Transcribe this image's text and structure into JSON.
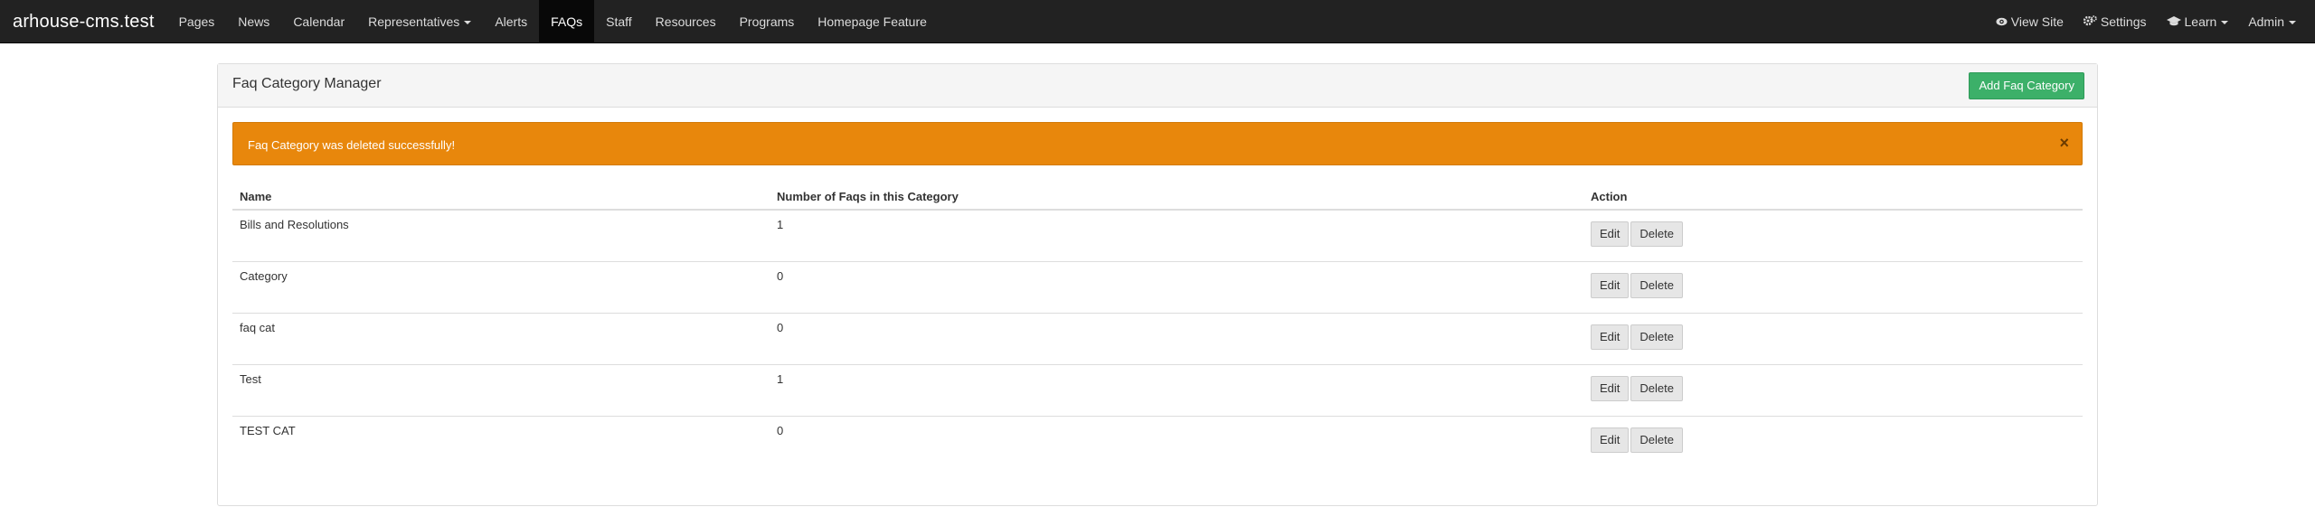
{
  "navbar": {
    "brand": "arhouse-cms.test",
    "items": [
      {
        "label": "Pages"
      },
      {
        "label": "News"
      },
      {
        "label": "Calendar"
      },
      {
        "label": "Representatives",
        "has_caret": true
      },
      {
        "label": "Alerts"
      },
      {
        "label": "FAQs",
        "active": true
      },
      {
        "label": "Staff"
      },
      {
        "label": "Resources"
      },
      {
        "label": "Programs"
      },
      {
        "label": "Homepage Feature"
      }
    ],
    "right": {
      "view_site": "View Site",
      "settings": "Settings",
      "learn": "Learn",
      "admin": "Admin"
    }
  },
  "panel": {
    "title": "Faq Category Manager",
    "add_button": "Add Faq Category"
  },
  "alert": {
    "message": "Faq Category was deleted successfully!",
    "close": "×",
    "color": "#e8870c"
  },
  "table": {
    "headers": {
      "name": "Name",
      "count": "Number of Faqs in this Category",
      "action": "Action"
    },
    "edit_label": "Edit",
    "delete_label": "Delete",
    "rows": [
      {
        "name": "Bills and Resolutions",
        "count": "1"
      },
      {
        "name": "Category",
        "count": "0"
      },
      {
        "name": "faq cat",
        "count": "0"
      },
      {
        "name": "Test",
        "count": "1"
      },
      {
        "name": "TEST CAT",
        "count": "0"
      }
    ]
  }
}
